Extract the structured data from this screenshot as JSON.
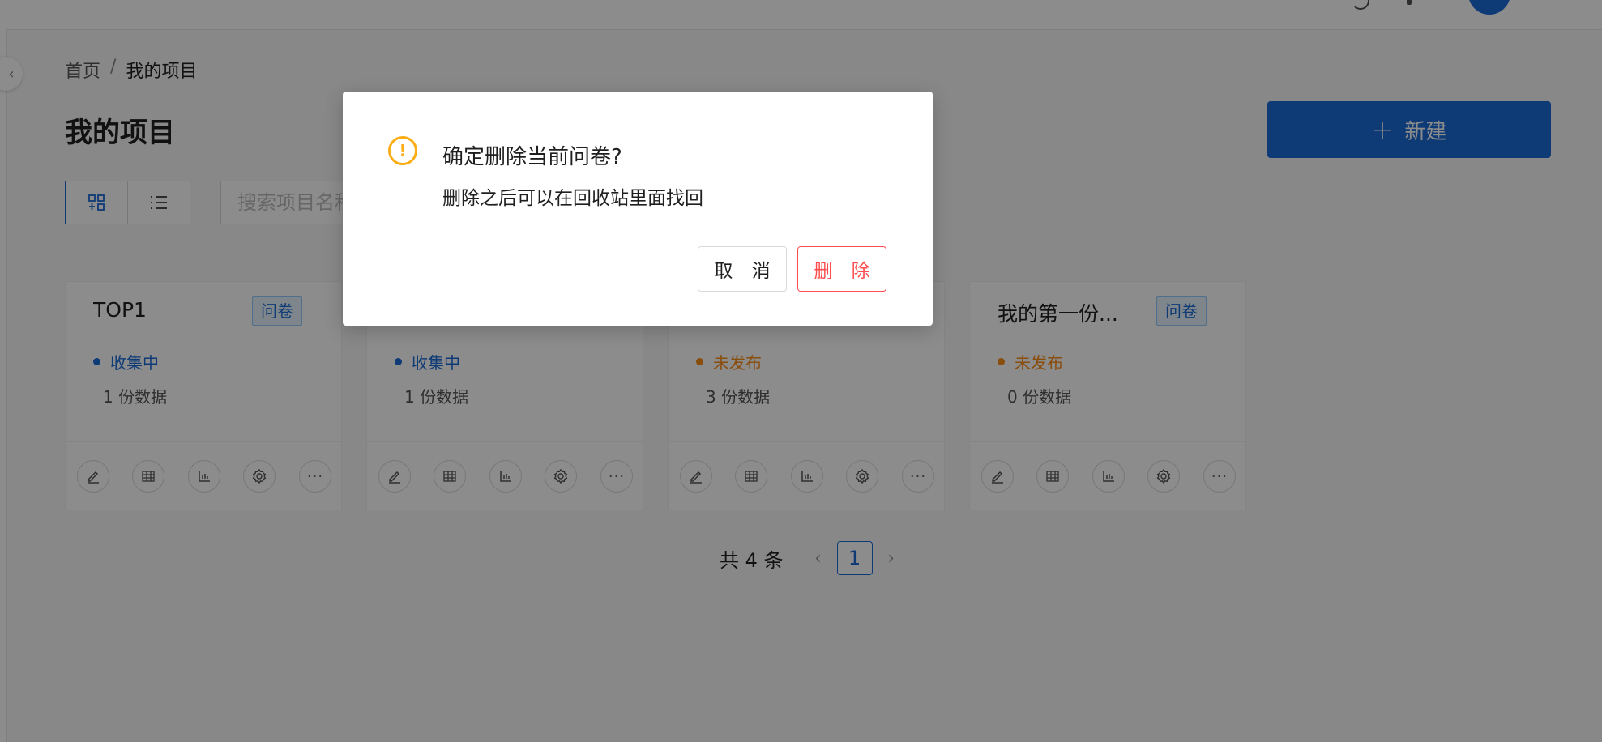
{
  "breadcrumb": {
    "home": "首页",
    "separator": "/",
    "current": "我的项目"
  },
  "page_title": "我的项目",
  "new_button": {
    "icon": "plus-icon",
    "label": "新建"
  },
  "view_switch": [
    {
      "icon": "grid-view-icon",
      "active": true
    },
    {
      "icon": "list-view-icon",
      "active": false
    }
  ],
  "search": {
    "placeholder": "搜索项目名称"
  },
  "cards": [
    {
      "name": "TOP1",
      "tag": "问卷",
      "status": "收集中",
      "status_color": "#1a6bd8",
      "count": "1 份数据"
    },
    {
      "name": "",
      "tag": "",
      "status": "收集中",
      "status_color": "#1a6bd8",
      "count": "1 份数据"
    },
    {
      "name": "",
      "tag": "",
      "status": "未发布",
      "status_color": "#fa8c16",
      "count": "3 份数据"
    },
    {
      "name": "我的第一份...",
      "tag": "问卷",
      "status": "未发布",
      "status_color": "#fa8c16",
      "count": "0 份数据"
    }
  ],
  "card_actions": [
    "edit-icon",
    "table-icon",
    "chart-icon",
    "settings-icon",
    "more-icon"
  ],
  "pagination": {
    "total": "共 4 条",
    "current_page": "1"
  },
  "modal": {
    "icon": "warning-icon",
    "title": "确定删除当前问卷?",
    "content": "删除之后可以在回收站里面找回",
    "cancel_label": "取 消",
    "delete_label": "删 除"
  },
  "colors": {
    "primary": "#1a6bd8",
    "danger": "#ff4d4f",
    "warning": "#faad14"
  }
}
